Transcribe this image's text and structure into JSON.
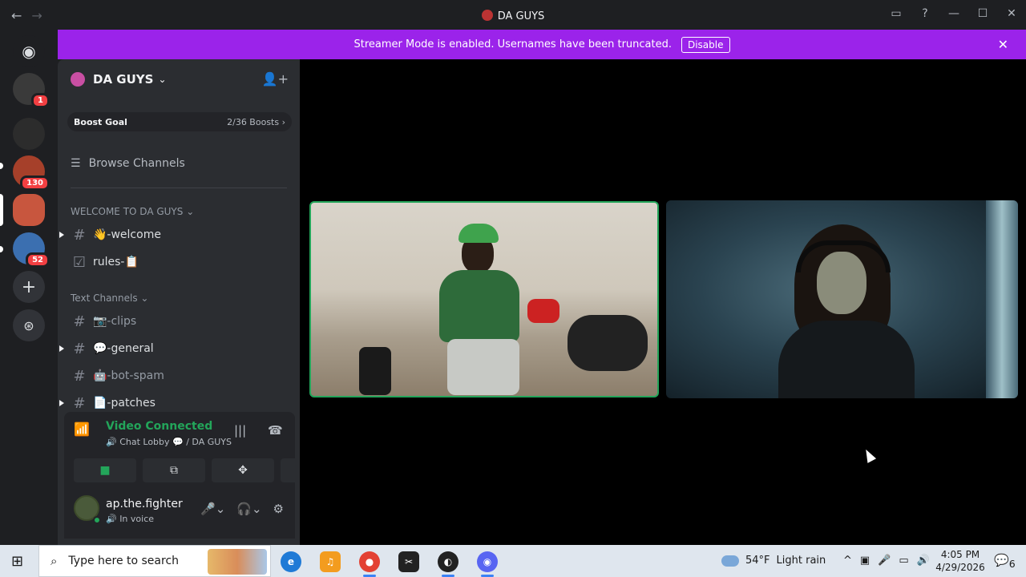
{
  "titlebar": {
    "title": "DA GUYS",
    "back": "←",
    "forward": "→",
    "inbox_icon": "inbox-icon",
    "help": "?",
    "minimize": "—",
    "maximize": "☐",
    "close": "✕"
  },
  "rail": {
    "items": [
      {
        "name": "discord-home",
        "glyph": "✉",
        "color": "#5865f2"
      },
      {
        "name": "server-1",
        "badge": "1",
        "color": "#444"
      },
      {
        "name": "server-2",
        "color": "#333"
      },
      {
        "name": "server-3",
        "badge": "130",
        "color": "#a6402a"
      },
      {
        "name": "server-da-guys",
        "color": "#c8563e"
      },
      {
        "name": "server-5",
        "badge": "52",
        "color": "#3b6fb0"
      }
    ],
    "add": "+",
    "explore": "⊛"
  },
  "banner": {
    "text": "Streamer Mode is enabled. Usernames have been truncated.",
    "disable": "Disable",
    "close": "✕"
  },
  "server": {
    "name": "DA GUYS",
    "chevron": "⌄",
    "invite_icon": "add-user-icon"
  },
  "boost": {
    "label": "Boost Goal",
    "progress": "2/36 Boosts",
    "chev": "›"
  },
  "browse": "Browse Channels",
  "categories": {
    "welcome": "WELCOME TO DA GUYS",
    "text": "Text Channels"
  },
  "channels": {
    "welcome": "👋-welcome",
    "rules": "rules-📋",
    "clips": "📷-clips",
    "general": "💬-general",
    "botspam": "🤖-bot-spam",
    "patches": "📄-patches"
  },
  "voice": {
    "status": "Video Connected",
    "location": "🔊 Chat Lobby 💬 / DA GUYS"
  },
  "user": {
    "name": "ap.the.fighter",
    "status": "🔊 In voice"
  },
  "taskbar": {
    "search_placeholder": "Type here to search",
    "weather_temp": "54°F",
    "weather_desc": "Light rain",
    "time": "4:05 PM",
    "date": "4/29/2026",
    "notif_count": "6"
  },
  "colors": {
    "accent": "#23a55a",
    "banner": "#9b23ea",
    "brand": "#5865f2"
  }
}
